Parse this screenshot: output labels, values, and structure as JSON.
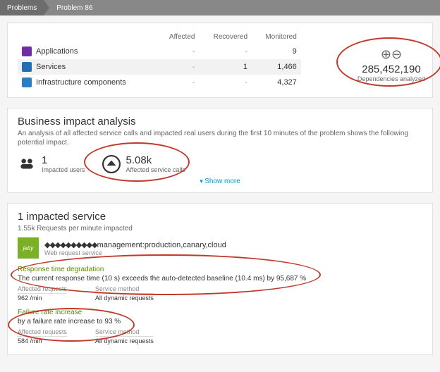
{
  "breadcrumb": {
    "root": "Problems",
    "current": "Problem 86"
  },
  "summary": {
    "headers": {
      "affected": "Affected",
      "recovered": "Recovered",
      "monitored": "Monitored"
    },
    "rows": [
      {
        "icon": "applications-icon",
        "label": "Applications",
        "affected": "-",
        "recovered": "-",
        "monitored": "9"
      },
      {
        "icon": "services-icon",
        "label": "Services",
        "affected": "-",
        "recovered": "1",
        "monitored": "1,466"
      },
      {
        "icon": "infra-icon",
        "label": "Infrastructure components",
        "affected": "-",
        "recovered": "-",
        "monitored": "4,327"
      }
    ],
    "dependencies": {
      "value": "285,452,190",
      "label": "Dependencies analyzed"
    }
  },
  "impact": {
    "title": "Business impact analysis",
    "subtitle": "An analysis of all affected service calls and impacted real users during the first 10 minutes of the problem shows the following potential impact.",
    "users": {
      "value": "1",
      "label": "Impacted users"
    },
    "calls": {
      "value": "5.08k",
      "label": "Affected service calls"
    },
    "show_more": "Show more"
  },
  "services": {
    "title": "1 impacted service",
    "subtitle": "1.55k Requests per minute impacted",
    "service": {
      "name_suffix": "management:production,canary,cloud",
      "type": "Web request service"
    },
    "events": [
      {
        "title": "Response time degradation",
        "desc": "The current response time (10 s) exceeds the auto-detected baseline (10.4 ms) by 95,687 %",
        "affected_label": "Affected requests",
        "affected_value": "962 /min",
        "method_label": "Service method",
        "method_value": "All dynamic requests"
      },
      {
        "title": "Failure rate increase",
        "desc": "by a failure rate increase to 93 %",
        "affected_label": "Affected requests",
        "affected_value": "584 /min",
        "method_label": "Service method",
        "method_value": "All dynamic requests"
      }
    ]
  }
}
